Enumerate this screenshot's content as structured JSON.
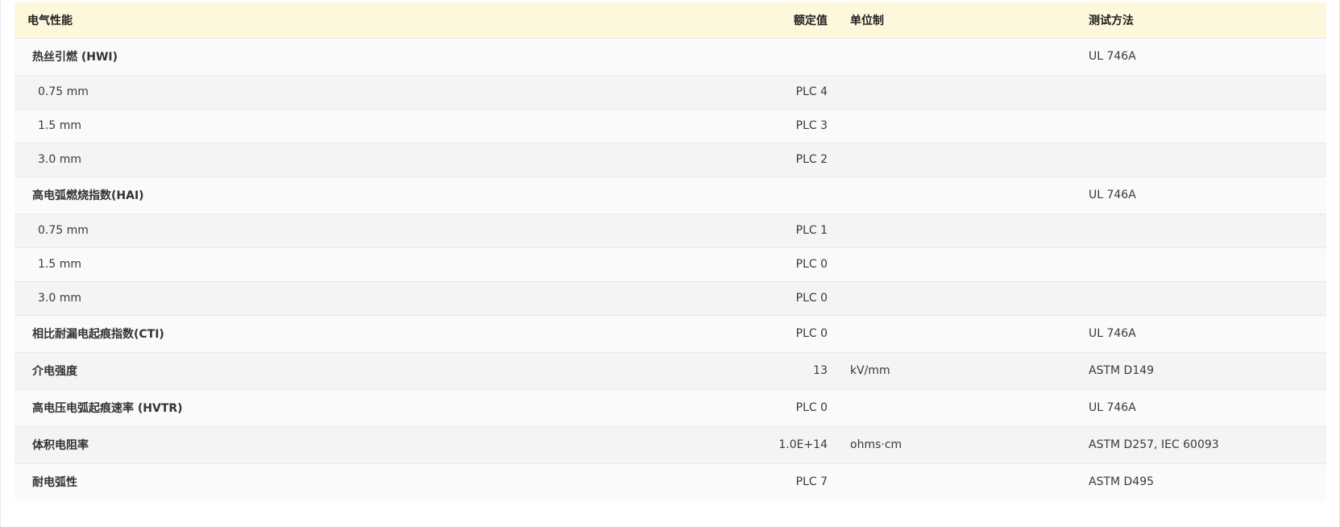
{
  "table": {
    "headers": {
      "property": "电气性能",
      "rated_value": "额定值",
      "unit": "单位制",
      "test_method": "测试方法"
    },
    "rows": [
      {
        "property": "热丝引燃 (HWI)",
        "rated": "",
        "unit": "",
        "method": "UL 746A",
        "kind": "main"
      },
      {
        "property": "0.75 mm",
        "rated": "PLC 4",
        "unit": "",
        "method": "",
        "kind": "sub"
      },
      {
        "property": "1.5 mm",
        "rated": "PLC 3",
        "unit": "",
        "method": "",
        "kind": "sub"
      },
      {
        "property": "3.0 mm",
        "rated": "PLC 2",
        "unit": "",
        "method": "",
        "kind": "sub"
      },
      {
        "property": "高电弧燃烧指数(HAI)",
        "rated": "",
        "unit": "",
        "method": "UL 746A",
        "kind": "main"
      },
      {
        "property": "0.75 mm",
        "rated": "PLC 1",
        "unit": "",
        "method": "",
        "kind": "sub"
      },
      {
        "property": "1.5 mm",
        "rated": "PLC 0",
        "unit": "",
        "method": "",
        "kind": "sub"
      },
      {
        "property": "3.0 mm",
        "rated": "PLC 0",
        "unit": "",
        "method": "",
        "kind": "sub"
      },
      {
        "property": "相比耐漏电起痕指数(CTI)",
        "rated": "PLC 0",
        "unit": "",
        "method": "UL 746A",
        "kind": "main"
      },
      {
        "property": "介电强度",
        "rated": "13",
        "unit": "kV/mm",
        "method": "ASTM D149",
        "kind": "main"
      },
      {
        "property": "高电压电弧起痕速率 (HVTR)",
        "rated": "PLC 0",
        "unit": "",
        "method": "UL 746A",
        "kind": "main"
      },
      {
        "property": "体积电阻率",
        "rated": "1.0E+14",
        "unit": "ohms·cm",
        "method": "ASTM D257, IEC 60093",
        "kind": "main"
      },
      {
        "property": "耐电弧性",
        "rated": "PLC 7",
        "unit": "",
        "method": "ASTM D495",
        "kind": "main"
      }
    ]
  },
  "colors": {
    "header_bg": "#fdf8dc",
    "row_light": "#fafafa",
    "row_dark": "#f4f4f4",
    "text": "#3a3a3a"
  }
}
